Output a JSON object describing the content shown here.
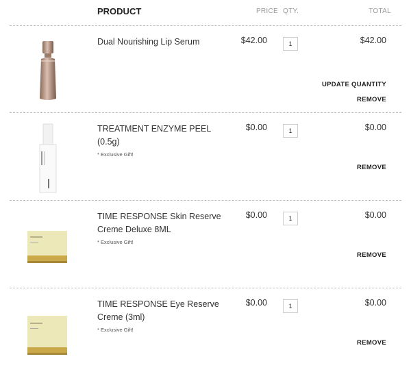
{
  "header": {
    "product": "PRODUCT",
    "price": "PRICE",
    "qty": "QTY.",
    "total": "TOTAL"
  },
  "items": [
    {
      "name": "Dual Nourishing Lip Serum",
      "price": "$42.00",
      "qty": "1",
      "total": "$42.00",
      "gift": "",
      "update_label": "UPDATE QUANTITY",
      "remove_label": "REMOVE",
      "image": "gold-bottle"
    },
    {
      "name": "TREATMENT ENZYME PEEL (0.5g)",
      "price": "$0.00",
      "qty": "1",
      "total": "$0.00",
      "gift": "* Exclusive Gift!",
      "remove_label": "REMOVE",
      "image": "white-tube"
    },
    {
      "name": "TIME RESPONSE Skin Reserve Creme Deluxe 8ML",
      "price": "$0.00",
      "qty": "1",
      "total": "$0.00",
      "gift": "* Exclusive Gift!",
      "remove_label": "REMOVE",
      "image": "cream-jar"
    },
    {
      "name": "TIME RESPONSE Eye Reserve Creme (3ml)",
      "price": "$0.00",
      "qty": "1",
      "total": "$0.00",
      "gift": "* Exclusive Gift!",
      "remove_label": "REMOVE",
      "image": "cream-jar"
    }
  ]
}
